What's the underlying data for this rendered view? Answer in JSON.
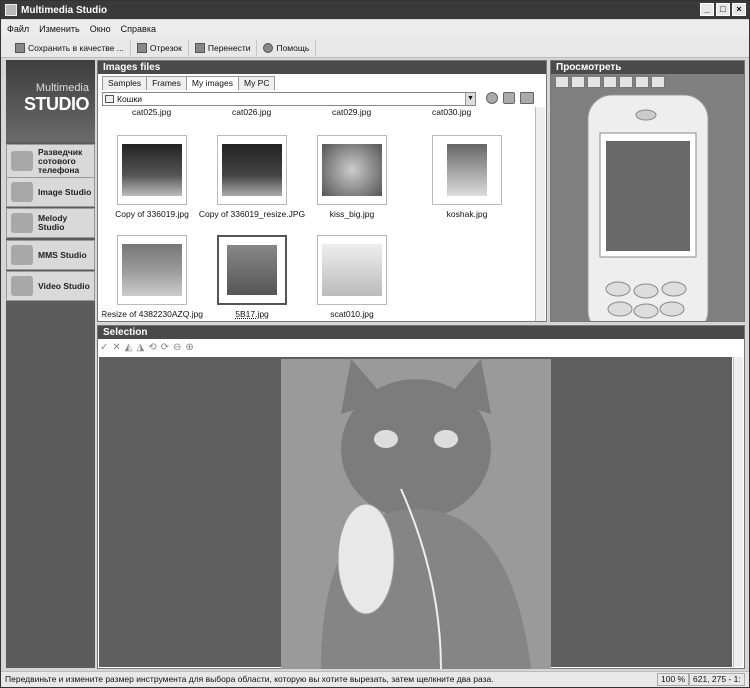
{
  "window": {
    "title": "Multimedia Studio",
    "buttons": [
      "_",
      "□",
      "×"
    ]
  },
  "menu": [
    "Файл",
    "Изменить",
    "Окно",
    "Справка"
  ],
  "toolbar": {
    "save": "Сохранить в качестве ...",
    "crop": "Отрезок",
    "move": "Перенести",
    "help": "Помощь"
  },
  "sidebar": {
    "logo_line1": "Multimedia",
    "logo_line2": "STUDIO",
    "items": [
      {
        "label": "Разведчик сотового телефона",
        "icon": "phone-explorer-icon"
      },
      {
        "label": "Image Studio",
        "icon": "image-studio-icon"
      },
      {
        "label": "Melody Studio",
        "icon": "melody-studio-icon"
      },
      {
        "label": "MMS Studio",
        "icon": "mms-studio-icon"
      },
      {
        "label": "Video Studio",
        "icon": "video-studio-icon"
      }
    ]
  },
  "images_panel": {
    "title": "Images files",
    "tabs": [
      "Samples",
      "Frames",
      "My images",
      "My PC"
    ],
    "active_tab": "My images",
    "path": "Кошки",
    "top_labels": [
      "cat025.jpg",
      "cat026.jpg",
      "cat029.jpg",
      "cat030.jpg"
    ],
    "files": [
      {
        "name": "Copy of 336019.jpg",
        "selected": false
      },
      {
        "name": "Copy of 336019_resize.JPG",
        "selected": false
      },
      {
        "name": "kiss_big.jpg",
        "selected": false
      },
      {
        "name": "koshak.jpg",
        "selected": false
      },
      {
        "name": "Resize of 4382230AZQ.jpg",
        "selected": false
      },
      {
        "name": "5B17.jpg",
        "selected": true
      },
      {
        "name": "scat010.jpg",
        "selected": false
      }
    ]
  },
  "preview_panel": {
    "title": "Просмотреть"
  },
  "selection_panel": {
    "title": "Selection"
  },
  "status": {
    "message": "Передвиньте и измените размер инструмента для выбора области, которую вы хотите вырезать, затем щелкните два раза.",
    "zoom": "100 %",
    "coords": "621, 275 - 1:"
  }
}
